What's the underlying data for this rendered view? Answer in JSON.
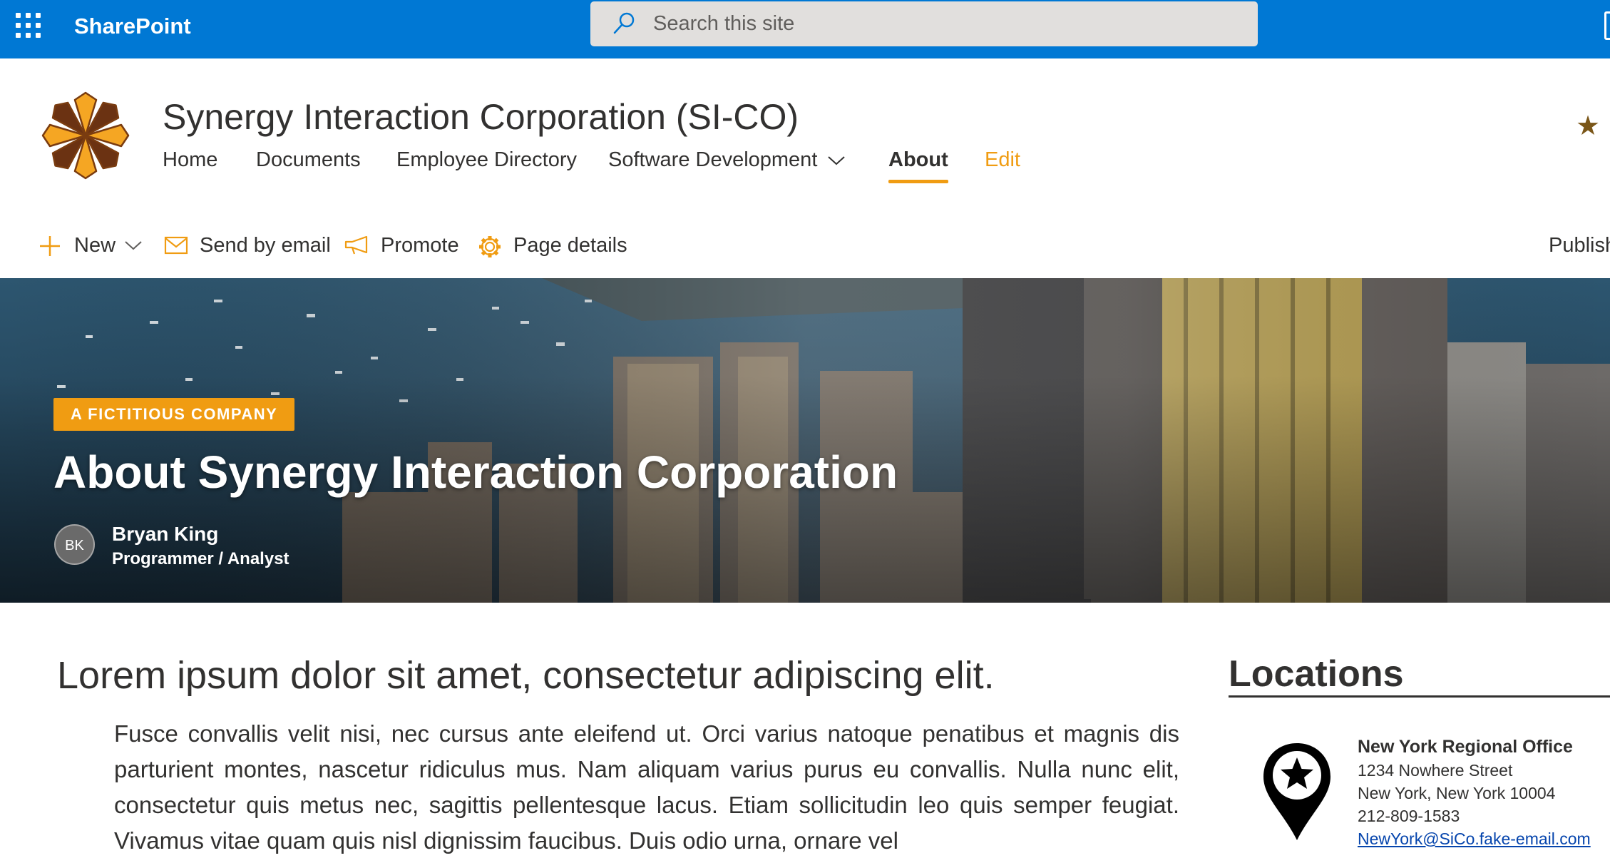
{
  "suite": {
    "brand": "SharePoint",
    "search_placeholder": "Search this site",
    "icons": [
      "waffle-icon",
      "search-icon"
    ],
    "color": "#0078d4"
  },
  "site": {
    "title": "Synergy Interaction Corporation (SI-CO)",
    "nav": {
      "home": "Home",
      "documents": "Documents",
      "employee_directory": "Employee Directory",
      "software_development": "Software Development",
      "about": "About",
      "edit": "Edit"
    },
    "active_nav": "About",
    "follow_icon": "star-icon",
    "accent_color": "#f09c12"
  },
  "commandbar": {
    "new": "New",
    "send_by_email": "Send by email",
    "promote": "Promote",
    "page_details": "Page details",
    "publish": "Publish"
  },
  "hero": {
    "topic": "A FICTITIOUS COMPANY",
    "title": "About Synergy Interaction Corporation",
    "author": {
      "initials": "BK",
      "name": "Bryan King",
      "role": "Programmer / Analyst"
    }
  },
  "content": {
    "headline": "Lorem ipsum dolor sit amet, consectetur adipiscing elit.",
    "paragraph": "Fusce convallis velit nisi, nec cursus ante eleifend ut. Orci varius natoque penatibus et magnis dis parturient montes, nascetur ridiculus mus. Nam aliquam varius purus eu convallis. Nulla nunc elit, consectetur quis metus nec, sagittis pellentesque lacus. Etiam sollicitudin leo quis semper feugiat. Vivamus vitae quam quis nisl dignissim faucibus. Duis odio urna, ornare vel"
  },
  "locations": {
    "title": "Locations",
    "items": [
      {
        "name": "New York Regional Office",
        "street": "1234 Nowhere Street",
        "city": "New York, New York 10004",
        "phone": "212-809-1583",
        "email": "NewYork@SiCo.fake-email.com",
        "icon": "map-pin-star-icon"
      }
    ]
  }
}
